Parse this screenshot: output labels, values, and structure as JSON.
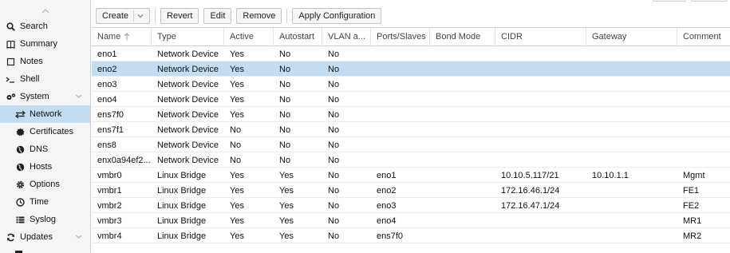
{
  "sidebar": {
    "items": [
      {
        "label": "Search",
        "icon": "search-icon",
        "level": 0
      },
      {
        "label": "Summary",
        "icon": "book-icon",
        "level": 0
      },
      {
        "label": "Notes",
        "icon": "note-icon",
        "level": 0
      },
      {
        "label": "Shell",
        "icon": "terminal-icon",
        "level": 0
      },
      {
        "label": "System",
        "icon": "cogs-icon",
        "level": 0,
        "expandable": true
      },
      {
        "label": "Network",
        "icon": "exchange-icon",
        "level": 1,
        "selected": true
      },
      {
        "label": "Certificates",
        "icon": "certificate-icon",
        "level": 1
      },
      {
        "label": "DNS",
        "icon": "globe-icon",
        "level": 1
      },
      {
        "label": "Hosts",
        "icon": "globe-icon",
        "level": 1
      },
      {
        "label": "Options",
        "icon": "gear-icon",
        "level": 1
      },
      {
        "label": "Time",
        "icon": "clock-icon",
        "level": 1
      },
      {
        "label": "Syslog",
        "icon": "list-icon",
        "level": 1
      },
      {
        "label": "Updates",
        "icon": "refresh-icon",
        "level": 0,
        "expandable": true
      }
    ]
  },
  "toolbar": {
    "create_label": "Create",
    "revert_label": "Revert",
    "edit_label": "Edit",
    "remove_label": "Remove",
    "apply_label": "Apply Configuration"
  },
  "grid": {
    "columns": [
      "Name",
      "Type",
      "Active",
      "Autostart",
      "VLAN a...",
      "Ports/Slaves",
      "Bond Mode",
      "CIDR",
      "Gateway",
      "Comment"
    ],
    "rows": [
      [
        "eno1",
        "Network Device",
        "Yes",
        "No",
        "No",
        "",
        "",
        "",
        "",
        ""
      ],
      [
        "eno2",
        "Network Device",
        "Yes",
        "No",
        "No",
        "",
        "",
        "",
        "",
        ""
      ],
      [
        "eno3",
        "Network Device",
        "Yes",
        "No",
        "No",
        "",
        "",
        "",
        "",
        ""
      ],
      [
        "eno4",
        "Network Device",
        "Yes",
        "No",
        "No",
        "",
        "",
        "",
        "",
        ""
      ],
      [
        "ens7f0",
        "Network Device",
        "Yes",
        "No",
        "No",
        "",
        "",
        "",
        "",
        ""
      ],
      [
        "ens7f1",
        "Network Device",
        "No",
        "No",
        "No",
        "",
        "",
        "",
        "",
        ""
      ],
      [
        "ens8",
        "Network Device",
        "No",
        "No",
        "No",
        "",
        "",
        "",
        "",
        ""
      ],
      [
        "enx0a94ef2...",
        "Network Device",
        "No",
        "No",
        "No",
        "",
        "",
        "",
        "",
        ""
      ],
      [
        "vmbr0",
        "Linux Bridge",
        "Yes",
        "Yes",
        "No",
        "eno1",
        "",
        "10.10.5.117/21",
        "10.10.1.1",
        "Mgmt"
      ],
      [
        "vmbr1",
        "Linux Bridge",
        "Yes",
        "Yes",
        "No",
        "eno2",
        "",
        "172.16.46.1/24",
        "",
        "FE1"
      ],
      [
        "vmbr2",
        "Linux Bridge",
        "Yes",
        "Yes",
        "No",
        "eno3",
        "",
        "172.16.47.1/24",
        "",
        "FE2"
      ],
      [
        "vmbr3",
        "Linux Bridge",
        "Yes",
        "Yes",
        "No",
        "eno4",
        "",
        "",
        "",
        "MR1"
      ],
      [
        "vmbr4",
        "Linux Bridge",
        "Yes",
        "Yes",
        "No",
        "ens7f0",
        "",
        "",
        "",
        "MR2"
      ]
    ],
    "selected_row": 1
  },
  "colors": {
    "selection": "#c2ddf2",
    "sidebar_bg": "#f5f5f5",
    "border": "#d0d0d0"
  }
}
